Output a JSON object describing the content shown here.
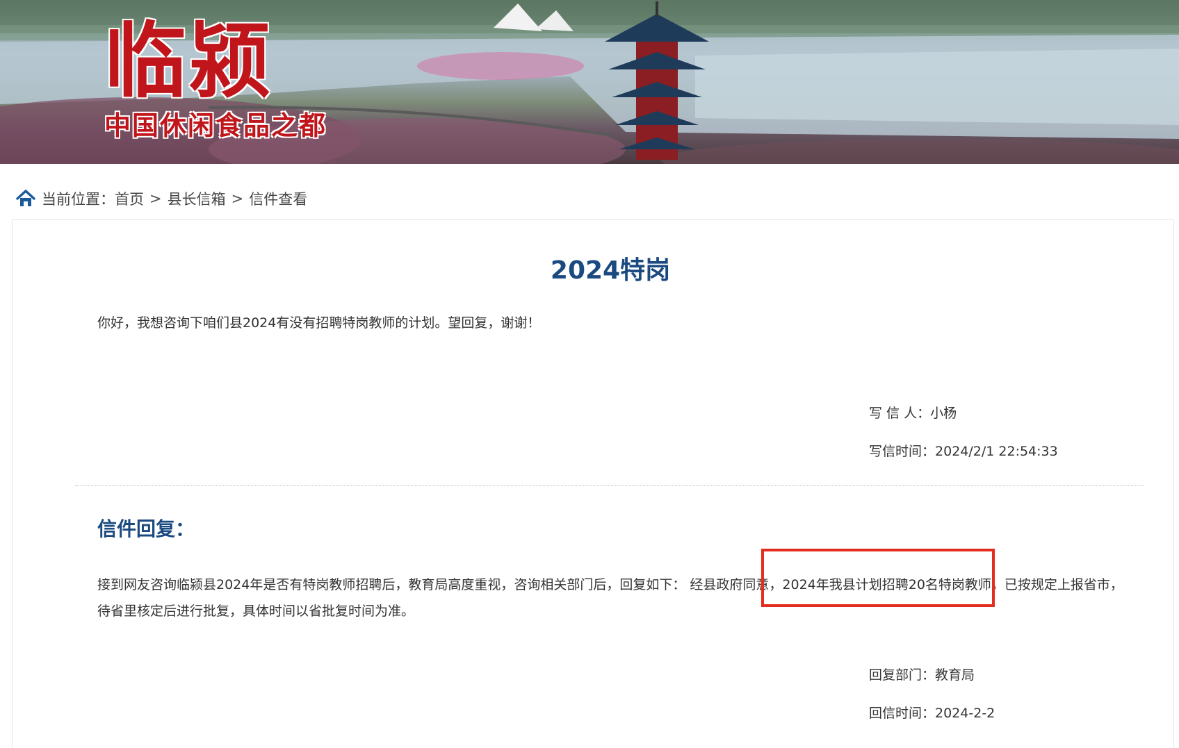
{
  "banner": {
    "logo_text": "临颍",
    "slogan": "中国休闲食品之都"
  },
  "breadcrumb": {
    "prefix": "当前位置：",
    "items": [
      "首页",
      "县长信箱",
      "信件查看"
    ],
    "separator": ">"
  },
  "letter": {
    "title": "2024特岗",
    "content": "你好，我想咨询下咱们县2024有没有招聘特岗教师的计划。望回复，谢谢！",
    "writer_label": "写 信 人：",
    "writer": "小杨",
    "time_label": "写信时间：",
    "time": "2024/2/1 22:54:33"
  },
  "reply": {
    "heading": "信件回复：",
    "content": "接到网友咨询临颍县2024年是否有特岗教师招聘后，教育局高度重视，咨询相关部门后，回复如下： 经县政府同意，2024年我县计划招聘20名特岗教师，已按规定上报省市，待省里核定后进行批复，具体时间以省批复时间为准。",
    "dept_label": "回复部门：",
    "dept": "教育局",
    "time_label": "回信时间：",
    "time": "2024-2-2"
  },
  "colors": {
    "title_blue": "#1a4a80",
    "highlight_red": "#e32d1f",
    "logo_red": "#c0151b"
  }
}
